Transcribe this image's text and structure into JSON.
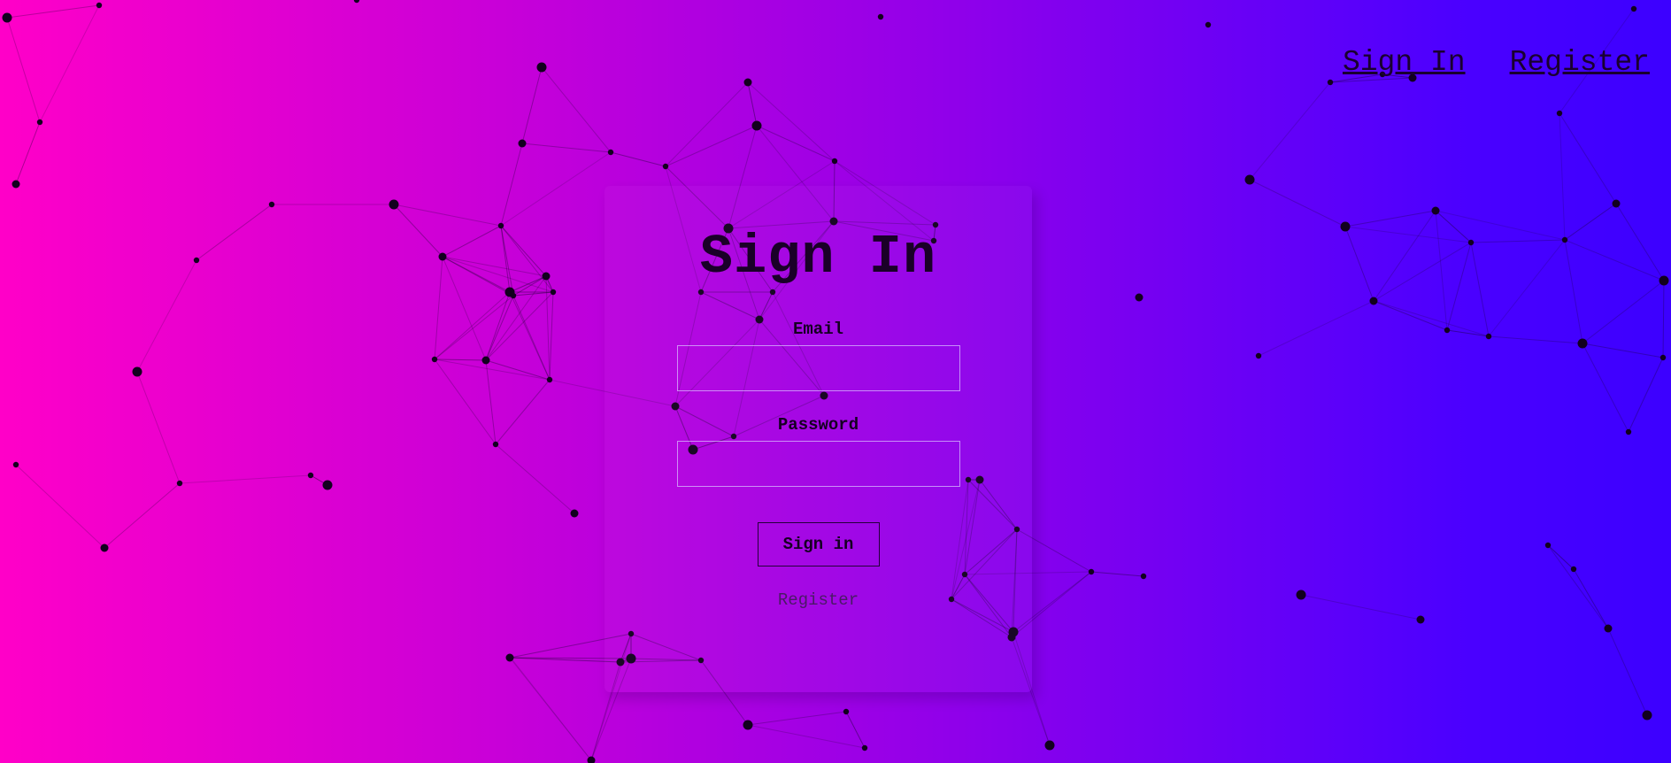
{
  "nav": {
    "signin_label": "Sign In",
    "register_label": "Register"
  },
  "form": {
    "title": "Sign In",
    "email_label": "Email",
    "email_value": "",
    "password_label": "Password",
    "password_value": "",
    "submit_label": "Sign in",
    "register_link": "Register"
  },
  "colors": {
    "gradient_start": "#ff00c8",
    "gradient_end": "#3c00ff",
    "network_lines": "#1a0030"
  }
}
